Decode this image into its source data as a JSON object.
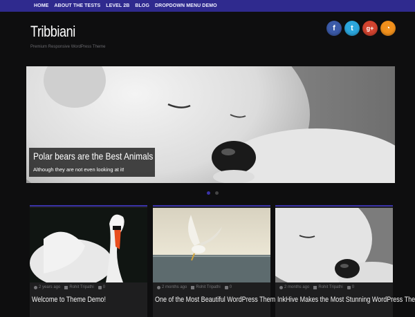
{
  "nav": {
    "items": [
      {
        "label": "HOME"
      },
      {
        "label": "ABOUT THE TESTS"
      },
      {
        "label": "LEVEL 2B"
      },
      {
        "label": "BLOG"
      },
      {
        "label": "DROPDOWN MENU DEMO"
      }
    ]
  },
  "site": {
    "title": "Tribbiani",
    "description": "Premium Responsive WordPress Theme"
  },
  "social": [
    {
      "icon": "facebook-icon",
      "glyph": "f",
      "color": "#3b5aa8"
    },
    {
      "icon": "twitter-icon",
      "glyph": "t",
      "color": "#2ba6dd"
    },
    {
      "icon": "google-plus-icon",
      "glyph": "g+",
      "color": "#d2432f"
    },
    {
      "icon": "rss-icon",
      "glyph": "◔",
      "color": "#f1901c"
    }
  ],
  "slider": {
    "caption_title": "Polar bears are the Best Animals",
    "caption_subtitle": "Although they are not even looking at it!",
    "active_slide": 1,
    "slide_count": 2
  },
  "posts": [
    {
      "date": "2 years ago",
      "author": "Rohit Tripathi",
      "comments": "0",
      "title": "Welcome to Theme Demo!"
    },
    {
      "date": "2 months ago",
      "author": "Rohit Tripathi",
      "comments": "0",
      "title": "One of the Most Beautiful WordPress Themes"
    },
    {
      "date": "2 months ago",
      "author": "Rohit Tripathi",
      "comments": "0",
      "title": "InkHive Makes the Most Stunning WordPress Themes"
    }
  ],
  "colors": {
    "accent": "#2f2a8e",
    "background": "#0e0e0f",
    "card": "#1e1e1f"
  }
}
